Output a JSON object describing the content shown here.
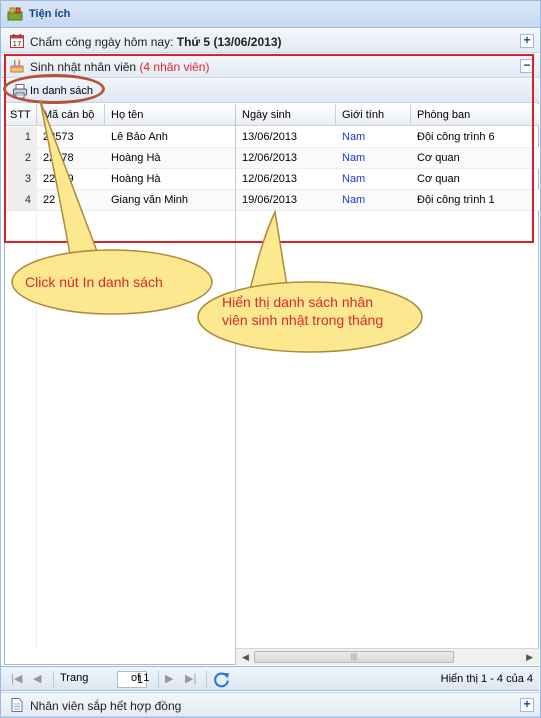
{
  "panel": {
    "title": "Tiện ích"
  },
  "timesheet": {
    "label": "Chấm công ngày hôm nay: ",
    "value": "Thứ 5 (13/06/2013)",
    "expand_symbol": "+"
  },
  "birthday": {
    "label": "Sinh nhật nhân viên ",
    "count": "(4 nhân viên)",
    "collapse_symbol": "−"
  },
  "toolbar": {
    "print_label": "In danh sách"
  },
  "grid": {
    "columns": [
      "STT",
      "Mã cán bộ",
      "Họ tên",
      "Ngày sinh",
      "Giới tính",
      "Phòng ban"
    ],
    "rows": [
      {
        "stt": "1",
        "code": "22573",
        "name": "Lê Bảo Anh",
        "dob": "13/06/2013",
        "gender": "Nam",
        "dept": "Đội công trình 6"
      },
      {
        "stt": "2",
        "code": "22578",
        "name": "Hoàng Hà",
        "dob": "12/06/2013",
        "gender": "Nam",
        "dept": "Cơ quan"
      },
      {
        "stt": "3",
        "code": "22579",
        "name": "Hoàng Hà",
        "dob": "12/06/2013",
        "gender": "Nam",
        "dept": "Cơ quan"
      },
      {
        "stt": "4",
        "code": "22",
        "name": "Giang văn Minh",
        "dob": "19/06/2013",
        "gender": "Nam",
        "dept": "Đội công trình 1"
      }
    ]
  },
  "pager": {
    "page_label": "Trang",
    "page_value": "1",
    "of_label": "of 1",
    "display_text": "Hiển thị 1 - 4 của 4"
  },
  "expiring_contracts": {
    "label": "Nhân viên sắp hết hợp đồng",
    "expand_symbol": "+"
  },
  "annotations": {
    "callout_1": "Click nút In danh sách",
    "callout_2_line1": "Hiển thị danh sách nhân",
    "callout_2_line2": "viên sinh nhật trong tháng"
  },
  "colors": {
    "header_text": "#15428b",
    "highlight_red": "#e0262b",
    "callout_fill": "#fbe88f",
    "callout_stroke": "#b08a3a",
    "gender_blue": "#1a3bd6"
  }
}
